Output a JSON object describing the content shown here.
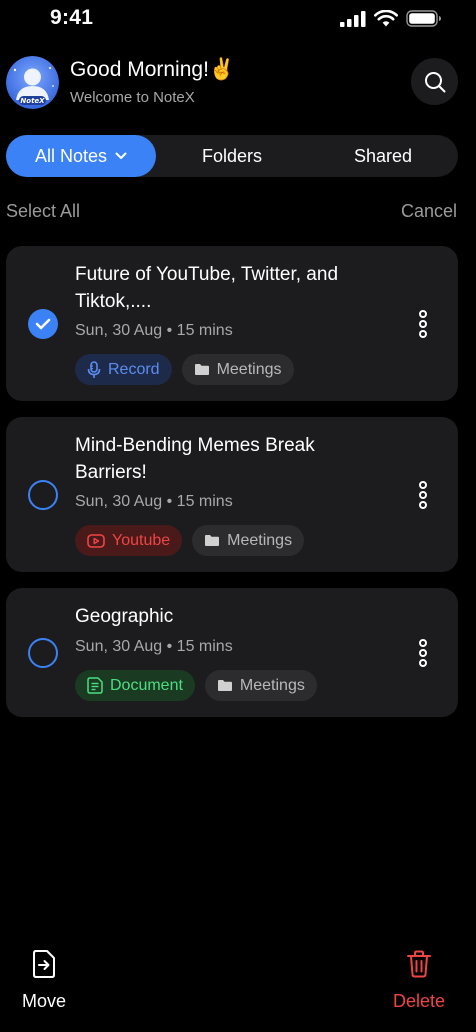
{
  "status_bar": {
    "time": "9:41"
  },
  "header": {
    "greeting": "Good Morning!✌️",
    "subtitle": "Welcome to NoteX",
    "avatar_text": "NoteX"
  },
  "tabs": [
    {
      "label": "All Notes",
      "active": true
    },
    {
      "label": "Folders",
      "active": false
    },
    {
      "label": "Shared",
      "active": false
    }
  ],
  "selection": {
    "select_all": "Select All",
    "cancel": "Cancel"
  },
  "notes": [
    {
      "title": "Future of YouTube, Twitter, and Tiktok,....",
      "meta": "Sun, 30 Aug • 15 mins",
      "selected": true,
      "source_tag": "Record",
      "source_icon": "microphone-icon",
      "folder_tag": "Meetings"
    },
    {
      "title": "Mind-Bending Memes Break Barriers!",
      "meta": "Sun, 30 Aug • 15 mins",
      "selected": false,
      "source_tag": "Youtube",
      "source_icon": "youtube-icon",
      "folder_tag": "Meetings"
    },
    {
      "title": "Geographic",
      "meta": "Sun, 30 Aug • 15 mins",
      "selected": false,
      "source_tag": "Document",
      "source_icon": "document-icon",
      "folder_tag": "Meetings"
    }
  ],
  "bottom_bar": {
    "move_label": "Move",
    "delete_label": "Delete"
  },
  "colors": {
    "accent": "#3b82f6",
    "record": "#5b8def",
    "youtube": "#ef4444",
    "document": "#4ade80",
    "delete": "#ef4444",
    "card": "#1c1c1e"
  }
}
